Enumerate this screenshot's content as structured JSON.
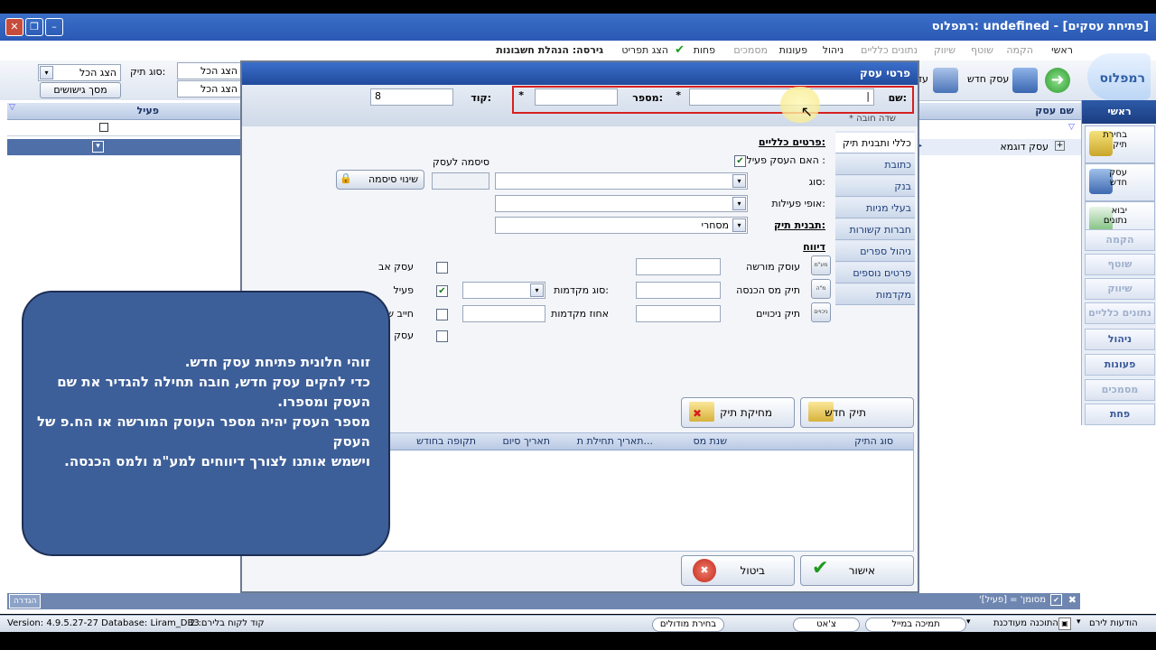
{
  "window": {
    "title": "רמפלוס: undefined - [פתיחת עסקים]"
  },
  "menu": {
    "items": [
      "ראשי",
      "הקמה",
      "שוטף",
      "שיווק",
      "נתונים כלליים",
      "ניהול",
      "פעונות",
      "מסמכים",
      "פחות",
      "הצג תפריט",
      "גירסה: הנהלת חשבונות"
    ]
  },
  "toolbar": {
    "new_business": "עסק חדש",
    "next_label": "עד"
  },
  "left_filter": {
    "file_type_label": "סוג תיק:",
    "file_type_value": "הצג הכל",
    "show_all_1": "הצג הכל",
    "show_all_2": "הצג הכל",
    "records_button": "מסך גישושים"
  },
  "grid": {
    "col_business_name": "שם עסק",
    "col_active": "פעיל",
    "row_example": "עסק דוגמא"
  },
  "sidebar": {
    "main": "ראשי",
    "select_file": "בחירת תיק",
    "new_business": "עסק חדש",
    "import_data": "יבוא נתונים",
    "items": [
      "הקמה",
      "שוטף",
      "שיווק",
      "נתונים כלליים",
      "ניהול",
      "פעונות",
      "מסמכים",
      "פחת"
    ]
  },
  "dialog": {
    "title": "פרטי עסק",
    "name_label": "שם:",
    "name_value": "|",
    "number_label": "מספר:",
    "number_value": "",
    "code_label": "קוד:",
    "code_value": "8",
    "required_note": "* שדה חובה",
    "tabs": [
      "כללי ותבנית תיק",
      "כתובת",
      "בנק",
      "בעלי מניות",
      "חברות קשורות",
      "ניהול ספרים",
      "פרטים נוספים",
      "מקדמות"
    ],
    "general_title": "פרטים כלליים:",
    "active_question": "האם העסק פעיל :",
    "type_label": "סוג:",
    "business_password_label": "סיסמה לעסק",
    "change_password": "שינוי סיסמה",
    "activity_label": "אופי פעילות:",
    "template_label": "תבנית תיק:",
    "template_value": "מסחרי",
    "reporting_title": "דיווח",
    "reporting_rows": [
      {
        "label": "עוסק מורשה",
        "icon": "vat"
      },
      {
        "label": "תיק מס הכנסה",
        "icon": "income"
      },
      {
        "label": "תיק ניכויים",
        "icon": "deduct"
      }
    ],
    "parent_business": "עסק אב",
    "active": "פעיל",
    "obligated": "חייב שידר",
    "exempt": "עסק פטור",
    "advances_type": "סוג מקדמות:",
    "advances_percent": "אחוז מקדמות",
    "new_file": "תיק חדש",
    "delete_file": "מחיקת תיק",
    "table_headers": [
      "סוג התיק",
      "שנת מס",
      "תאריך תחילת ת...",
      "תאריך סיום",
      "תקופה בחודש"
    ],
    "ok": "אישור",
    "cancel": "ביטול"
  },
  "balloon": {
    "lines": [
      "זוהי חלונית פתיחת עסק חדש.",
      "כדי להקים עסק חדש, חובה תחילה להגדיר את שם העסק ומספרו.",
      "מספר העסק יהיה מספר העוסק המורשה או הח.פ של העסק",
      " וישמש אותנו לצורך דיווחים למע\"מ ולמס הכנסה."
    ]
  },
  "filter_bar": {
    "text": "'מסומן' = [פעיל]",
    "define": "הגדרה"
  },
  "status": {
    "version": "Version: 4.9.5.27-27  Database: Liram_DB3",
    "client_code": "קוד לקוח בלירם: 2",
    "modules": "בחירת מודולים",
    "chat": "צ'אט",
    "remote_support": "תמיכה במייל",
    "updates": "התוכנה מעודכנת",
    "messages": "הודעות לירם"
  }
}
